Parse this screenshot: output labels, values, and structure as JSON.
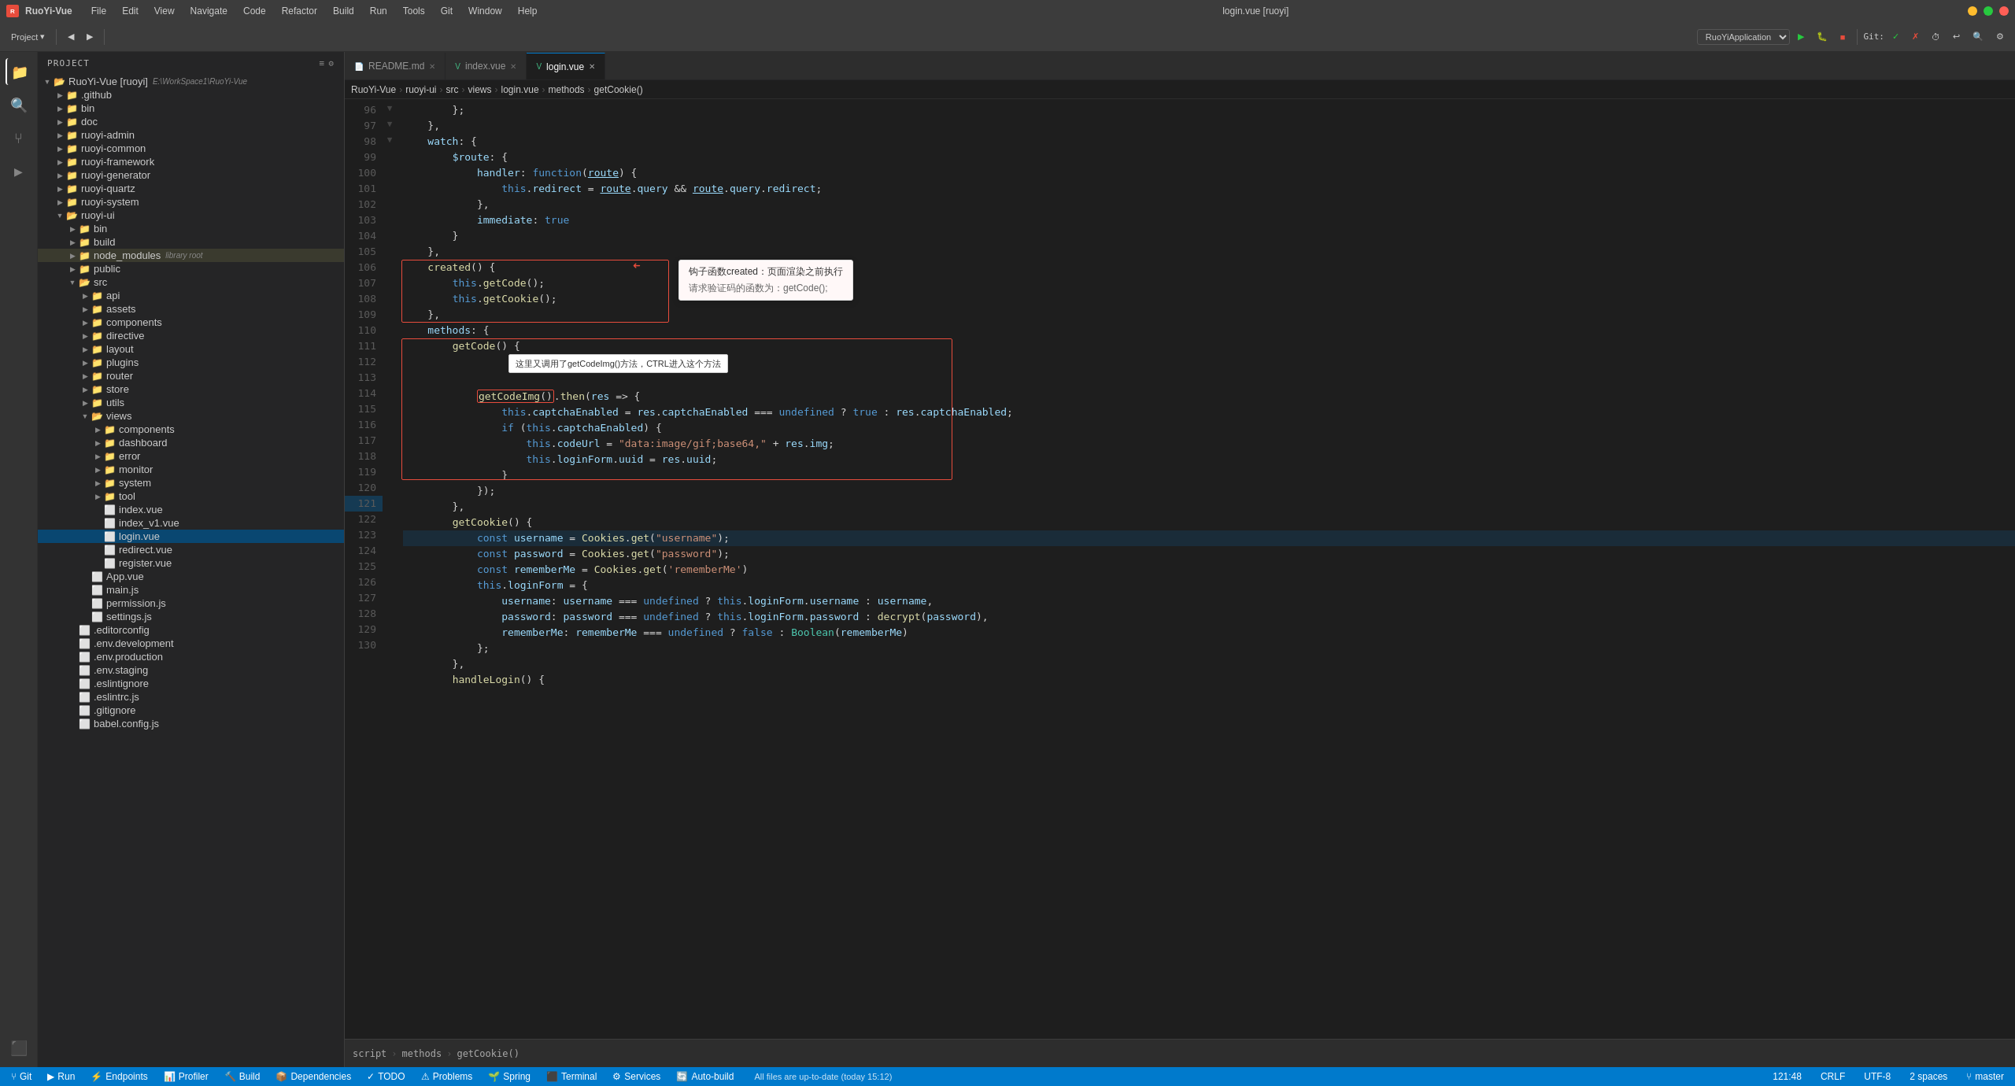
{
  "titleBar": {
    "appName": "RuoYi-Vue",
    "subtitle": "login.vue [ruoyi]",
    "menuItems": [
      "File",
      "Edit",
      "View",
      "Navigate",
      "Code",
      "Refactor",
      "Build",
      "Run",
      "Tools",
      "Git",
      "Window",
      "Help"
    ]
  },
  "toolbar": {
    "projectLabel": "Project",
    "branchDropdown": "RuoYiApplication",
    "gitStatus": "Git:"
  },
  "tabs": [
    {
      "label": "README.md",
      "icon": "📄",
      "active": false
    },
    {
      "label": "index.vue",
      "icon": "🖊",
      "active": false
    },
    {
      "label": "login.vue",
      "icon": "🖊",
      "active": true
    }
  ],
  "breadcrumb": {
    "items": [
      "RuoYi-Vue",
      "ruoyi-ui",
      "src",
      "views",
      "login.vue",
      "methods",
      "getCookie()"
    ]
  },
  "sidebar": {
    "title": "Project",
    "items": [
      {
        "label": "RuoYi-Vue [ruoyi]",
        "path": "E:\\WorkSpace1\\RuoYi-Vue",
        "indent": 0,
        "type": "root",
        "expanded": true
      },
      {
        "label": ".github",
        "indent": 1,
        "type": "folder",
        "expanded": false
      },
      {
        "label": "bin",
        "indent": 1,
        "type": "folder",
        "expanded": false
      },
      {
        "label": "doc",
        "indent": 1,
        "type": "folder",
        "expanded": false
      },
      {
        "label": "ruoyi-admin",
        "indent": 1,
        "type": "folder",
        "expanded": false
      },
      {
        "label": "ruoyi-common",
        "indent": 1,
        "type": "folder",
        "expanded": false
      },
      {
        "label": "ruoyi-framework",
        "indent": 1,
        "type": "folder",
        "expanded": false
      },
      {
        "label": "ruoyi-generator",
        "indent": 1,
        "type": "folder",
        "expanded": false
      },
      {
        "label": "ruoyi-quartz",
        "indent": 1,
        "type": "folder",
        "expanded": false
      },
      {
        "label": "ruoyi-system",
        "indent": 1,
        "type": "folder",
        "expanded": false
      },
      {
        "label": "ruoyi-ui",
        "indent": 1,
        "type": "folder",
        "expanded": true
      },
      {
        "label": "bin",
        "indent": 2,
        "type": "folder",
        "expanded": false
      },
      {
        "label": "build",
        "indent": 2,
        "type": "folder",
        "expanded": false
      },
      {
        "label": "node_modules",
        "indent": 2,
        "type": "folder",
        "expanded": false,
        "badge": "library root"
      },
      {
        "label": "public",
        "indent": 2,
        "type": "folder",
        "expanded": false
      },
      {
        "label": "src",
        "indent": 2,
        "type": "folder",
        "expanded": true
      },
      {
        "label": "api",
        "indent": 3,
        "type": "folder",
        "expanded": false
      },
      {
        "label": "assets",
        "indent": 3,
        "type": "folder",
        "expanded": false
      },
      {
        "label": "components",
        "indent": 3,
        "type": "folder",
        "expanded": false
      },
      {
        "label": "directive",
        "indent": 3,
        "type": "folder",
        "expanded": false
      },
      {
        "label": "layout",
        "indent": 3,
        "type": "folder",
        "expanded": false
      },
      {
        "label": "plugins",
        "indent": 3,
        "type": "folder",
        "expanded": false
      },
      {
        "label": "router",
        "indent": 3,
        "type": "folder",
        "expanded": false
      },
      {
        "label": "store",
        "indent": 3,
        "type": "folder",
        "expanded": false
      },
      {
        "label": "utils",
        "indent": 3,
        "type": "folder",
        "expanded": false
      },
      {
        "label": "views",
        "indent": 3,
        "type": "folder",
        "expanded": true
      },
      {
        "label": "components",
        "indent": 4,
        "type": "folder",
        "expanded": false
      },
      {
        "label": "dashboard",
        "indent": 4,
        "type": "folder",
        "expanded": false
      },
      {
        "label": "error",
        "indent": 4,
        "type": "folder",
        "expanded": false
      },
      {
        "label": "monitor",
        "indent": 4,
        "type": "folder",
        "expanded": false
      },
      {
        "label": "system",
        "indent": 4,
        "type": "folder",
        "expanded": false
      },
      {
        "label": "tool",
        "indent": 4,
        "type": "folder",
        "expanded": false
      },
      {
        "label": "index.vue",
        "indent": 4,
        "type": "vue",
        "expanded": false
      },
      {
        "label": "index_v1.vue",
        "indent": 4,
        "type": "vue",
        "expanded": false
      },
      {
        "label": "login.vue",
        "indent": 4,
        "type": "vue",
        "expanded": false,
        "selected": true
      },
      {
        "label": "redirect.vue",
        "indent": 4,
        "type": "vue",
        "expanded": false
      },
      {
        "label": "register.vue",
        "indent": 4,
        "type": "vue",
        "expanded": false
      },
      {
        "label": "App.vue",
        "indent": 3,
        "type": "vue",
        "expanded": false
      },
      {
        "label": "main.js",
        "indent": 3,
        "type": "js",
        "expanded": false
      },
      {
        "label": "permission.js",
        "indent": 3,
        "type": "js",
        "expanded": false
      },
      {
        "label": "settings.js",
        "indent": 3,
        "type": "js",
        "expanded": false
      },
      {
        "label": ".editorconfig",
        "indent": 2,
        "type": "config",
        "expanded": false
      },
      {
        "label": ".env.development",
        "indent": 2,
        "type": "env",
        "expanded": false
      },
      {
        "label": ".env.production",
        "indent": 2,
        "type": "env",
        "expanded": false
      },
      {
        "label": ".env.staging",
        "indent": 2,
        "type": "env",
        "expanded": false
      },
      {
        "label": ".eslintignore",
        "indent": 2,
        "type": "config",
        "expanded": false
      },
      {
        "label": ".eslintrc.js",
        "indent": 2,
        "type": "js",
        "expanded": false
      },
      {
        "label": ".gitignore",
        "indent": 2,
        "type": "config",
        "expanded": false
      },
      {
        "label": "babel.config.js",
        "indent": 2,
        "type": "js",
        "expanded": false
      }
    ]
  },
  "codeLines": [
    {
      "num": 96,
      "code": "        };"
    },
    {
      "num": 97,
      "code": "    },"
    },
    {
      "num": 98,
      "code": "    watch: {"
    },
    {
      "num": 99,
      "code": "        $route: {"
    },
    {
      "num": 100,
      "code": "            handler: function(route) {"
    },
    {
      "num": 101,
      "code": "                this.redirect = route.query && route.query.redirect;"
    },
    {
      "num": 102,
      "code": "            },"
    },
    {
      "num": 103,
      "code": "            immediate: true"
    },
    {
      "num": 104,
      "code": "        }"
    },
    {
      "num": 105,
      "code": "    },"
    },
    {
      "num": 106,
      "code": "    created() {",
      "annotated": "created"
    },
    {
      "num": 107,
      "code": "        this.getCode();",
      "annotated": "created"
    },
    {
      "num": 108,
      "code": "        this.getCookie();",
      "annotated": "created"
    },
    {
      "num": 109,
      "code": "    },"
    },
    {
      "num": 110,
      "code": "    methods: {"
    },
    {
      "num": 111,
      "code": "        getCode() {",
      "annotated": "getcode"
    },
    {
      "num": 112,
      "code": "            getCodeImg().then(res => {",
      "annotated": "getcode"
    },
    {
      "num": 113,
      "code": "                this.captchaEnabled = res.captchaEnabled === undefined ? true : res.captchaEnabled;",
      "annotated": "getcode"
    },
    {
      "num": 114,
      "code": "                if (this.captchaEnabled) {",
      "annotated": "getcode"
    },
    {
      "num": 115,
      "code": "                    this.codeUrl = \"data:image/gif;base64,\" + res.img;",
      "annotated": "getcode"
    },
    {
      "num": 116,
      "code": "                    this.loginForm.uuid = res.uuid;",
      "annotated": "getcode"
    },
    {
      "num": 117,
      "code": "                }",
      "annotated": "getcode"
    },
    {
      "num": 118,
      "code": "            });",
      "annotated": "getcode"
    },
    {
      "num": 119,
      "code": "        },"
    },
    {
      "num": 120,
      "code": "        getCookie() {"
    },
    {
      "num": 121,
      "code": "            const username = Cookies.get(\"username\");",
      "highlighted": true
    },
    {
      "num": 122,
      "code": "            const password = Cookies.get(\"password\");"
    },
    {
      "num": 123,
      "code": "            const rememberMe = Cookies.get('rememberMe')"
    },
    {
      "num": 124,
      "code": "            this.loginForm = {"
    },
    {
      "num": 125,
      "code": "                username: username === undefined ? this.loginForm.username : username,"
    },
    {
      "num": 126,
      "code": "                password: password === undefined ? this.loginForm.password : decrypt(password),"
    },
    {
      "num": 127,
      "code": "                rememberMe: rememberMe === undefined ? false : Boolean(rememberMe)"
    },
    {
      "num": 128,
      "code": "            };"
    },
    {
      "num": 129,
      "code": "        },"
    },
    {
      "num": 130,
      "code": "        handleLogin() {"
    }
  ],
  "annotations": {
    "created": {
      "title": "钩子函数created：页面渲染之前执行",
      "subtitle": "请求验证码的函数为：getCode();"
    },
    "getcode": {
      "text": "这里又调用了getCodeImg()方法，CTRL进入这个方法"
    },
    "getCodeImg": "getCodeImg()"
  },
  "statusBar": {
    "git": "Git",
    "run": "Run",
    "endpoints": "Endpoints",
    "profiler": "Profiler",
    "build": "Build",
    "dependencies": "Dependencies",
    "todo": "TODO",
    "problems": "Problems",
    "spring": "Spring",
    "terminal": "Terminal",
    "services": "Services",
    "autoBuild": "Auto-build",
    "rightItems": {
      "position": "121:48",
      "lineEnding": "CRLF",
      "encoding": "UTF-8",
      "spaces": "2 spaces",
      "readMode": "master"
    },
    "bottomMsg": "All files are up-to-date (today 15:12)"
  }
}
